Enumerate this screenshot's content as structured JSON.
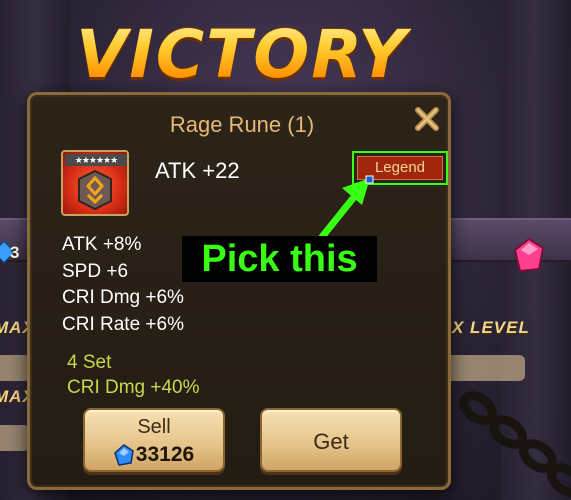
{
  "screen": {
    "title": "VICTORY"
  },
  "background": {
    "max_text_left": "MAX",
    "max_text_left_2": "MAX",
    "max_level_text": "X LEVEL",
    "left_count_digit": "3"
  },
  "popup": {
    "title": "Rage Rune (1)",
    "close_icon": "close-x-icon",
    "rune": {
      "stars": "★★★★★★",
      "icon": "rage-rune-icon"
    },
    "main_stat": "ATK +22",
    "grade_badge": "Legend",
    "substats": [
      "ATK +8%",
      "SPD +6",
      "CRI Dmg +6%",
      "CRI Rate +6%"
    ],
    "set_bonus": {
      "label": "4 Set",
      "effect": "CRI Dmg +40%"
    },
    "sell_button": {
      "label": "Sell",
      "price": "33126",
      "currency_icon": "crystal-icon"
    },
    "get_button": {
      "label": "Get"
    }
  },
  "annotation": {
    "text": "Pick this",
    "color": "#39ff14"
  },
  "colors": {
    "gold": "#ffb000",
    "legend_red": "#a0260e",
    "set_green": "#c8d84a",
    "panel_border": "#8a6a3a"
  }
}
